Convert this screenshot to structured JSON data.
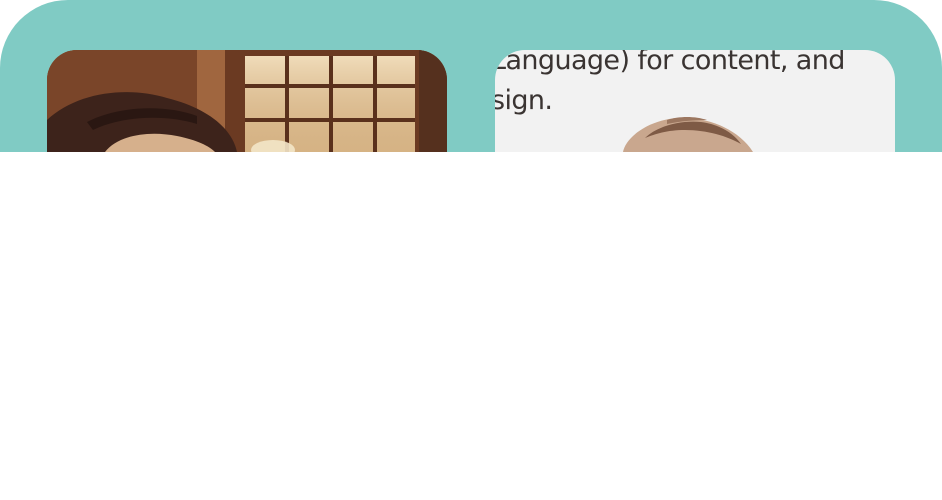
{
  "text_card": {
    "line_1": "Language) for content, and",
    "line_2": "sign."
  }
}
